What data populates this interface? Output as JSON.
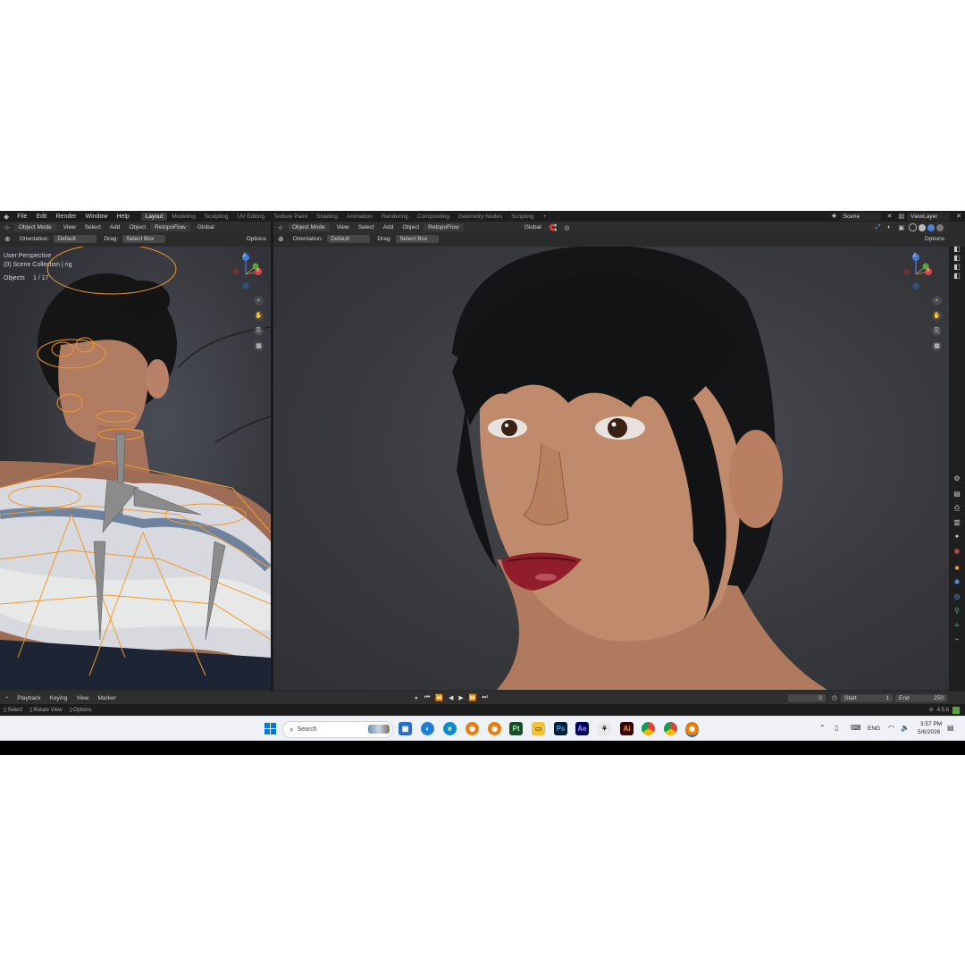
{
  "menu": [
    "File",
    "Edit",
    "Render",
    "Window",
    "Help"
  ],
  "workspace_tabs": [
    "Layout",
    "Modeling",
    "Sculpting",
    "UV Editing",
    "Texture Paint",
    "Shading",
    "Animation",
    "Rendering",
    "Compositing",
    "Geometry Nodes",
    "Scripting"
  ],
  "scene_name": "Scene",
  "view_layer": "ViewLayer",
  "header": {
    "mode": "Object Mode",
    "view": "View",
    "select": "Select",
    "add": "Add",
    "object": "Object",
    "addon": "RetopoFlow",
    "transform": "Global",
    "orientation_label": "Orientation:",
    "orientation_value": "Default",
    "drag_label": "Drag:",
    "drag_value": "Select Box",
    "options": "Options"
  },
  "left_viewport": {
    "view_name": "User Perspective",
    "collection": "(0) Scene Collection | rig",
    "objects_label": "Objects",
    "objects_count": "1 / 17"
  },
  "timeline": {
    "playback": "Playback",
    "keying": "Keying",
    "view": "View",
    "marker": "Marker",
    "current_frame": "0",
    "start_label": "Start",
    "start": "1",
    "end_label": "End",
    "end": "250"
  },
  "statusbar": {
    "select": "Select",
    "rotate": "Rotate View",
    "options": "Options",
    "version": "4.5.6"
  },
  "taskbar": {
    "search": "Search",
    "lang": "ENG",
    "time": "3:57 PM",
    "date": "5/6/2026",
    "apps": [
      {
        "label": "Pt",
        "color": "#1c4a2c",
        "fg": "#9cf09c"
      },
      {
        "label": "Ps",
        "color": "#001e36",
        "fg": "#31a8ff"
      },
      {
        "label": "Ae",
        "color": "#00005b",
        "fg": "#9999ff"
      },
      {
        "label": "Ai",
        "color": "#330000",
        "fg": "#ff9a00"
      }
    ]
  },
  "axis_labels": {
    "z": "Z",
    "x": "X",
    "y": "Y"
  }
}
